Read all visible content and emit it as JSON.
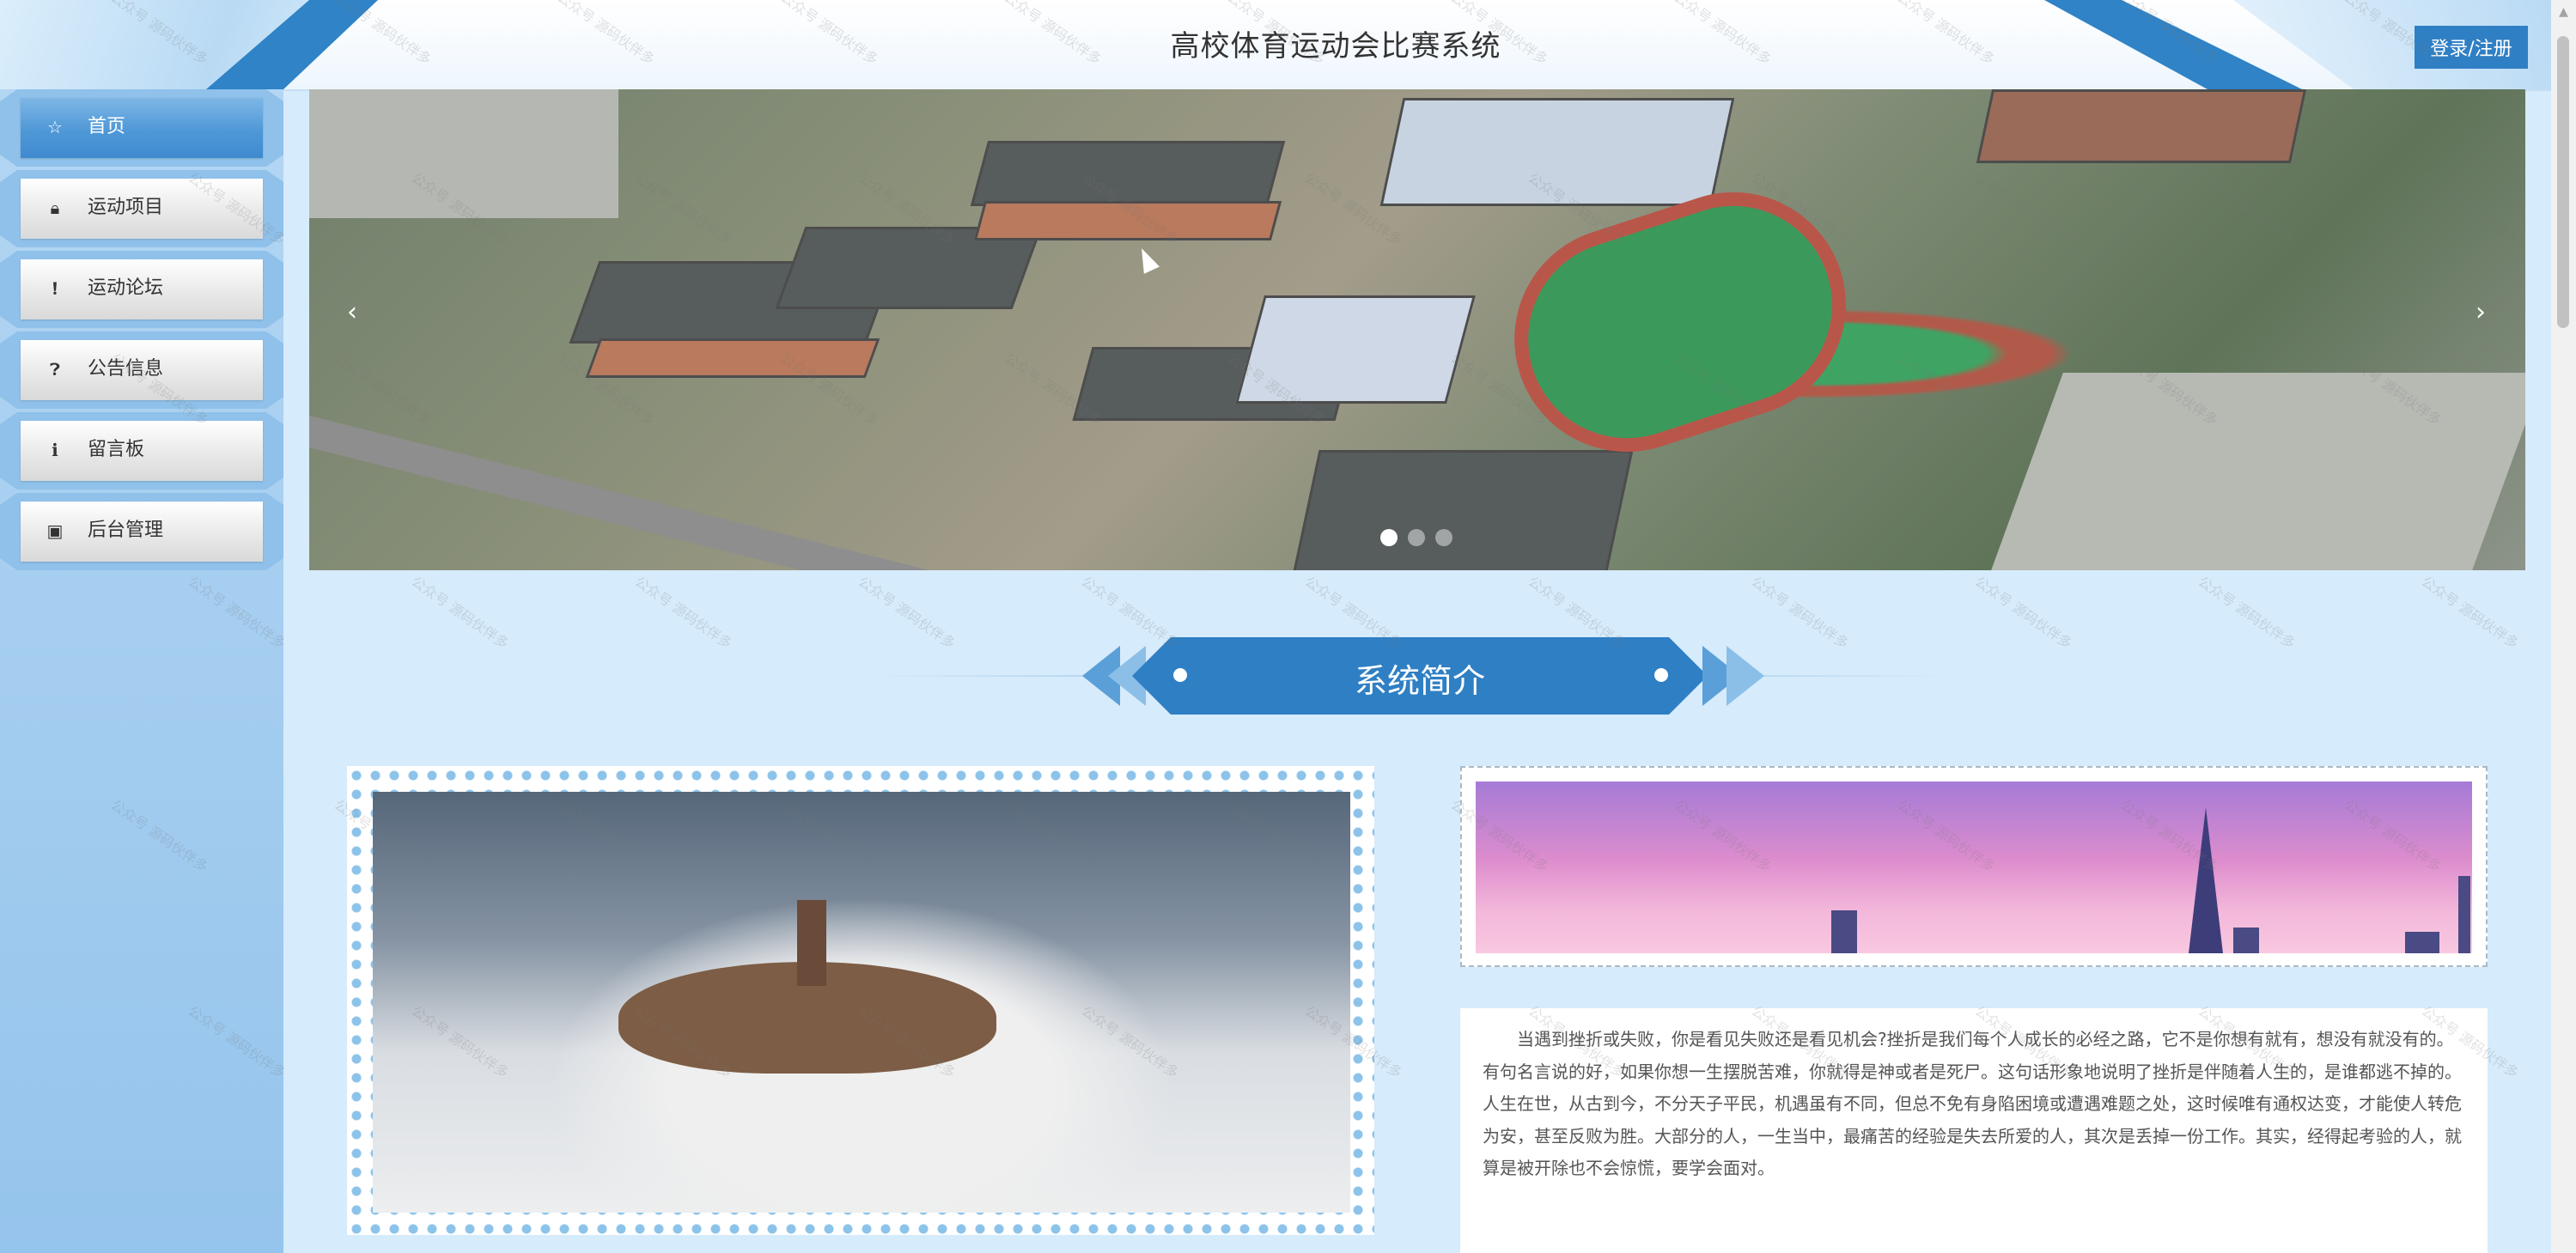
{
  "header": {
    "title": "高校体育运动会比赛系统",
    "login_label": "登录/注册"
  },
  "sidebar": {
    "items": [
      {
        "label": "首页",
        "icon": "star-icon",
        "glyph": "☆",
        "active": true
      },
      {
        "label": "运动项目",
        "icon": "lock-icon",
        "glyph": "🔒︎",
        "active": false
      },
      {
        "label": "运动论坛",
        "icon": "exclamation-circle-icon",
        "glyph": "❗︎",
        "active": false
      },
      {
        "label": "公告信息",
        "icon": "question-circle-icon",
        "glyph": "❓︎",
        "active": false
      },
      {
        "label": "留言板",
        "icon": "info-circle-icon",
        "glyph": "ℹ︎",
        "active": false
      },
      {
        "label": "后台管理",
        "icon": "briefcase-icon",
        "glyph": "▣",
        "active": false
      }
    ]
  },
  "banner": {
    "prev_glyph": "‹",
    "next_glyph": "›",
    "slide_count": 3,
    "active_slide": 1
  },
  "intro": {
    "section_title": "系统简介",
    "text": "当遇到挫折或失败，你是看见失败还是看见机会?挫折是我们每个人成长的必经之路，它不是你想有就有，想没有就没有的。有句名言说的好，如果你想一生摆脱苦难，你就得是神或者是死尸。这句话形象地说明了挫折是伴随着人生的，是谁都逃不掉的。人生在世，从古到今，不分天子平民，机遇虽有不同，但总不免有身陷困境或遭遇难题之处，这时候唯有通权达变，才能使人转危为安，甚至反败为胜。大部分的人，一生当中，最痛苦的经验是失去所爱的人，其次是丢掉一份工作。其实，经得起考验的人，就算是被开除也不会惊慌，要学会面对。"
  },
  "watermark": "公众号 源码伙伴多",
  "colors": {
    "accent": "#2f7fc4",
    "sidebar_bg": "#a8d0f1",
    "page_bg": "#d6ebfb"
  }
}
